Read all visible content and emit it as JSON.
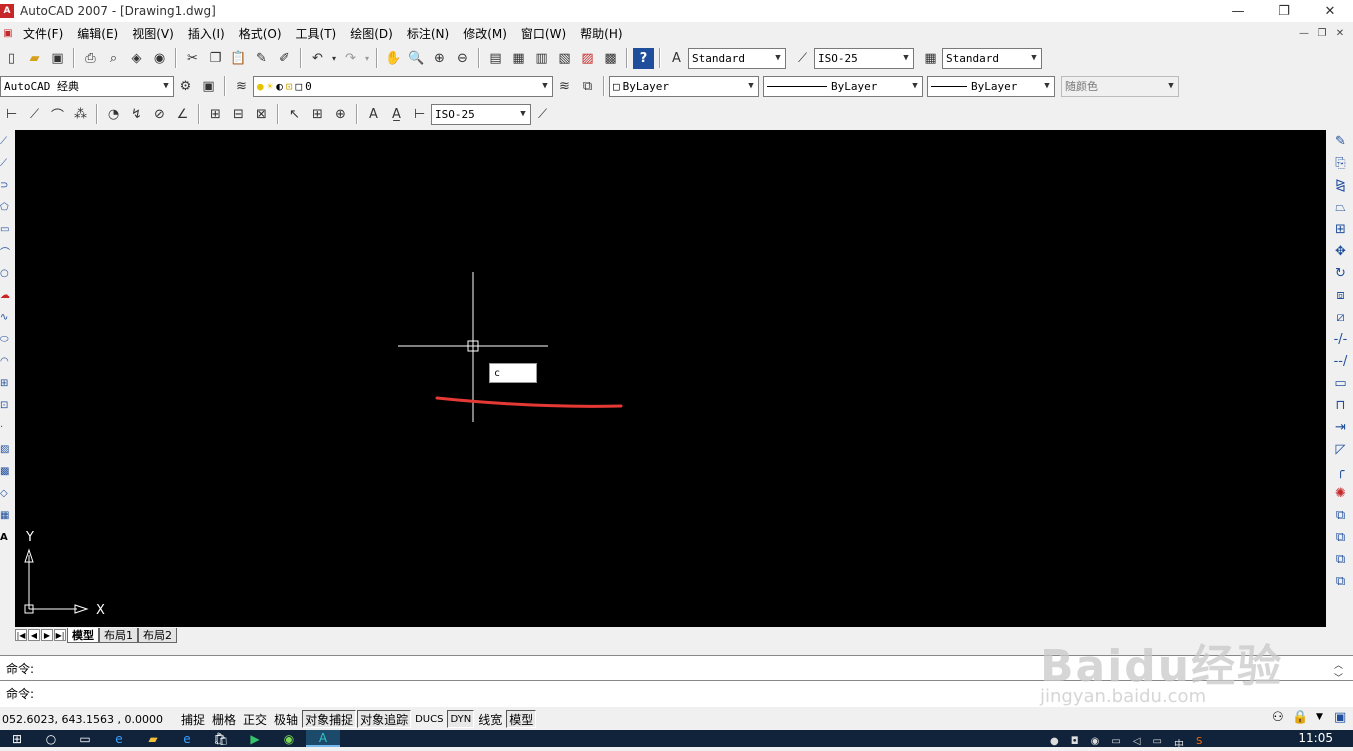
{
  "window": {
    "title": "AutoCAD 2007 - [Drawing1.dwg]",
    "app_icon": "A"
  },
  "menu": [
    "文件(F)",
    "编辑(E)",
    "视图(V)",
    "插入(I)",
    "格式(O)",
    "工具(T)",
    "绘图(D)",
    "标注(N)",
    "修改(M)",
    "窗口(W)",
    "帮助(H)"
  ],
  "toolbar1": {
    "text_style": "Standard",
    "dim_style": "ISO-25",
    "table_style": "Standard"
  },
  "toolbar2": {
    "workspace": "AutoCAD 经典",
    "layer": "0",
    "color": "ByLayer",
    "linetype": "ByLayer",
    "lineweight": "ByLayer",
    "plot_style": "随颜色"
  },
  "toolbar3": {
    "dim_style": "ISO-25"
  },
  "canvas": {
    "input_box": "c",
    "ucs_y": "Y",
    "ucs_x": "X",
    "annotation_color": "#e53935"
  },
  "tabs": [
    "模型",
    "布局1",
    "布局2"
  ],
  "command": {
    "line1": "命令:",
    "line2": "命令:"
  },
  "status": {
    "coords": "052.6023, 643.1563 , 0.0000",
    "toggles": [
      {
        "label": "捕捉",
        "on": false
      },
      {
        "label": "栅格",
        "on": false
      },
      {
        "label": "正交",
        "on": false
      },
      {
        "label": "极轴",
        "on": false
      },
      {
        "label": "对象捕捉",
        "on": true
      },
      {
        "label": "对象追踪",
        "on": true
      },
      {
        "label": "DUCS",
        "on": false
      },
      {
        "label": "DYN",
        "on": true
      },
      {
        "label": "线宽",
        "on": false
      },
      {
        "label": "模型",
        "on": true
      }
    ]
  },
  "taskbar": {
    "clock": "11:05",
    "ime": "中"
  },
  "watermark": {
    "brand": "Baidu经验",
    "url": "jingyan.baidu.com"
  }
}
